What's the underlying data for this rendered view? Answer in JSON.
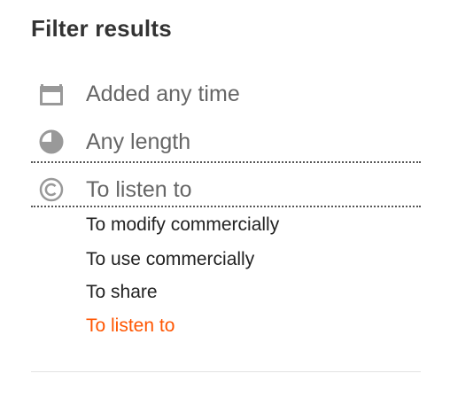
{
  "filter": {
    "title": "Filter results",
    "rows": [
      {
        "icon": "calendar-icon",
        "label": "Added any time"
      },
      {
        "icon": "clock-icon",
        "label": "Any length"
      },
      {
        "icon": "copyright-icon",
        "label": "To listen to"
      }
    ],
    "license_options": [
      {
        "label": "To modify commercially",
        "selected": false
      },
      {
        "label": "To use commercially",
        "selected": false
      },
      {
        "label": "To share",
        "selected": false
      },
      {
        "label": "To listen to",
        "selected": true
      }
    ]
  },
  "colors": {
    "title": "#333333",
    "row_label": "#666666",
    "icon": "#999999",
    "option": "#222222",
    "selected_option": "#ff5500"
  }
}
